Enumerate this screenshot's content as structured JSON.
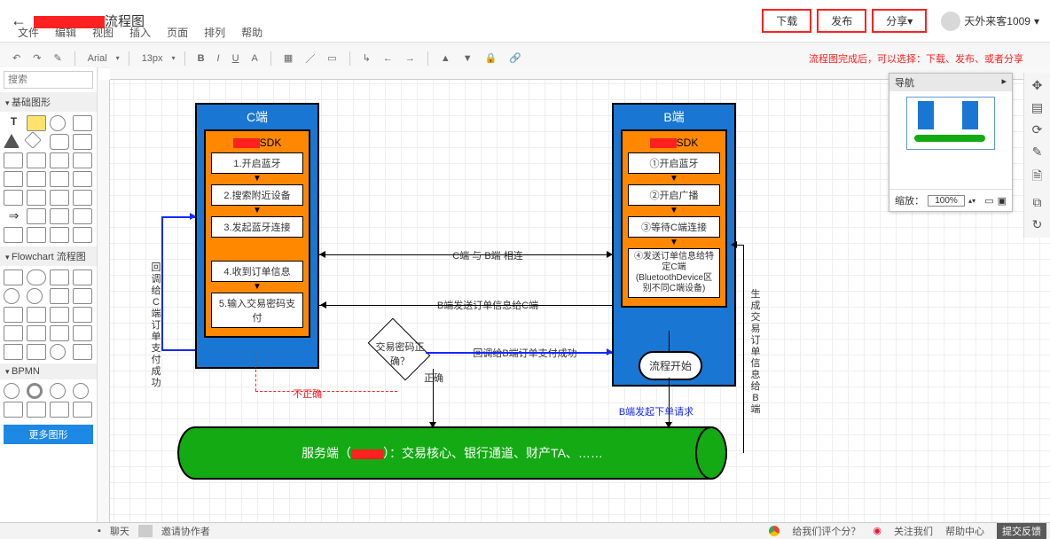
{
  "header": {
    "title_suffix": "流程图",
    "menus": [
      "文件",
      "编辑",
      "视图",
      "插入",
      "页面",
      "排列",
      "帮助"
    ],
    "actions": {
      "download": "下载",
      "publish": "发布",
      "share": "分享▾"
    },
    "user_name": "天外来客1009",
    "annotation": "流程图完成后，可以选择：下载、发布、或者分享"
  },
  "toolbar": {
    "font": "Arial",
    "size": "13px",
    "buttons": [
      "B",
      "I",
      "U",
      "A"
    ]
  },
  "shape_panel": {
    "search_placeholder": "搜索",
    "cat_basic": "基础图形",
    "cat_flow": "Flowchart 流程图",
    "cat_bpmn": "BPMN",
    "more": "更多图形"
  },
  "navigator": {
    "title": "导航",
    "zoom_label": "缩放：",
    "zoom_value": "100%"
  },
  "bottom": {
    "chat": "聊天",
    "invite": "邀请协作者",
    "rate": "给我们评个分？",
    "follow": "关注我们",
    "help": "帮助中心",
    "feedback": "提交反馈"
  },
  "flow": {
    "c_panel": {
      "title": "C端",
      "sdk_suffix": "SDK",
      "steps": [
        "1.开启蓝牙",
        "2.搜索附近设备",
        "3.发起蓝牙连接",
        "4.收到订单信息",
        "5.输入交易密码支付"
      ]
    },
    "b_panel": {
      "title": "B端",
      "sdk_suffix": "SDK",
      "steps": [
        "①开启蓝牙",
        "②开启广播",
        "③等待C端连接",
        "④发送订单信息给特定C端(BluetoothDevice区别不同C端设备)"
      ]
    },
    "start": "流程开始",
    "decision": "交易密码正确？",
    "dec_yes": "正确",
    "dec_no": "不正确",
    "labels": {
      "c_b_connect": "C端 与 B端 相连",
      "b_send_order": "B端发送订单信息给C端",
      "cb_success": "回调给B端订单支付成功",
      "callback_c": "回调给C端订单支付成功",
      "gen_order": "生成交易订单信息给B端",
      "b_request": "B端发起下单请求"
    },
    "server": {
      "prefix": "服务端（",
      "suffix": "）：交易核心、银行通道、财产TA、……"
    }
  }
}
